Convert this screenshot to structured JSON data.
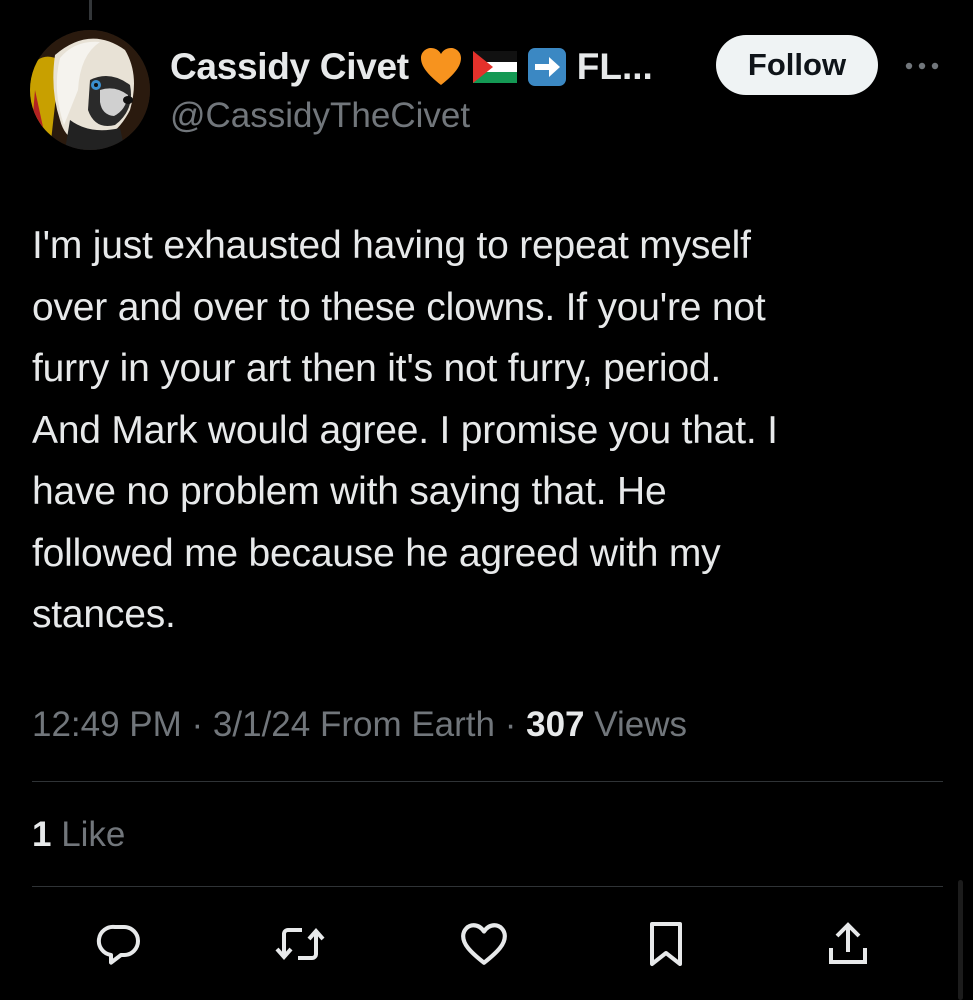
{
  "colors": {
    "background": "#000000",
    "text_primary": "#e7e9ea",
    "text_secondary": "#71767b",
    "divider": "#2f3336",
    "follow_bg": "#eff3f4",
    "heart_emoji": "#f7931e",
    "arrow_emoji": "#3b88c3"
  },
  "author": {
    "display_name": "Cassidy Civet",
    "name_emojis": [
      "orange-heart-icon",
      "palestine-flag-icon",
      "right-arrow-icon"
    ],
    "name_truncated_suffix": "FL...",
    "handle": "@CassidyTheCivet",
    "avatar_icon": "civet-avatar-icon"
  },
  "follow_button": {
    "label": "Follow"
  },
  "more_icon": "more-dots-icon",
  "tweet": {
    "lines": [
      "I'm just exhausted having to repeat myself",
      "over and over to these clowns. If you're not",
      "furry in your art then it's not furry, period.",
      "And Mark would agree. I promise you that. I",
      "have no problem with saying that. He",
      "followed me because he agreed with my",
      "stances."
    ]
  },
  "meta": {
    "time": "12:49 PM",
    "sep1": " · ",
    "date": "3/1/24",
    "source": " From Earth",
    "sep2": " · ",
    "views_count": "307",
    "views_label": " Views"
  },
  "engagement": {
    "likes_count": "1",
    "likes_label": " Like"
  },
  "actions": [
    "reply-icon",
    "retweet-icon",
    "like-icon",
    "bookmark-icon",
    "share-icon"
  ]
}
